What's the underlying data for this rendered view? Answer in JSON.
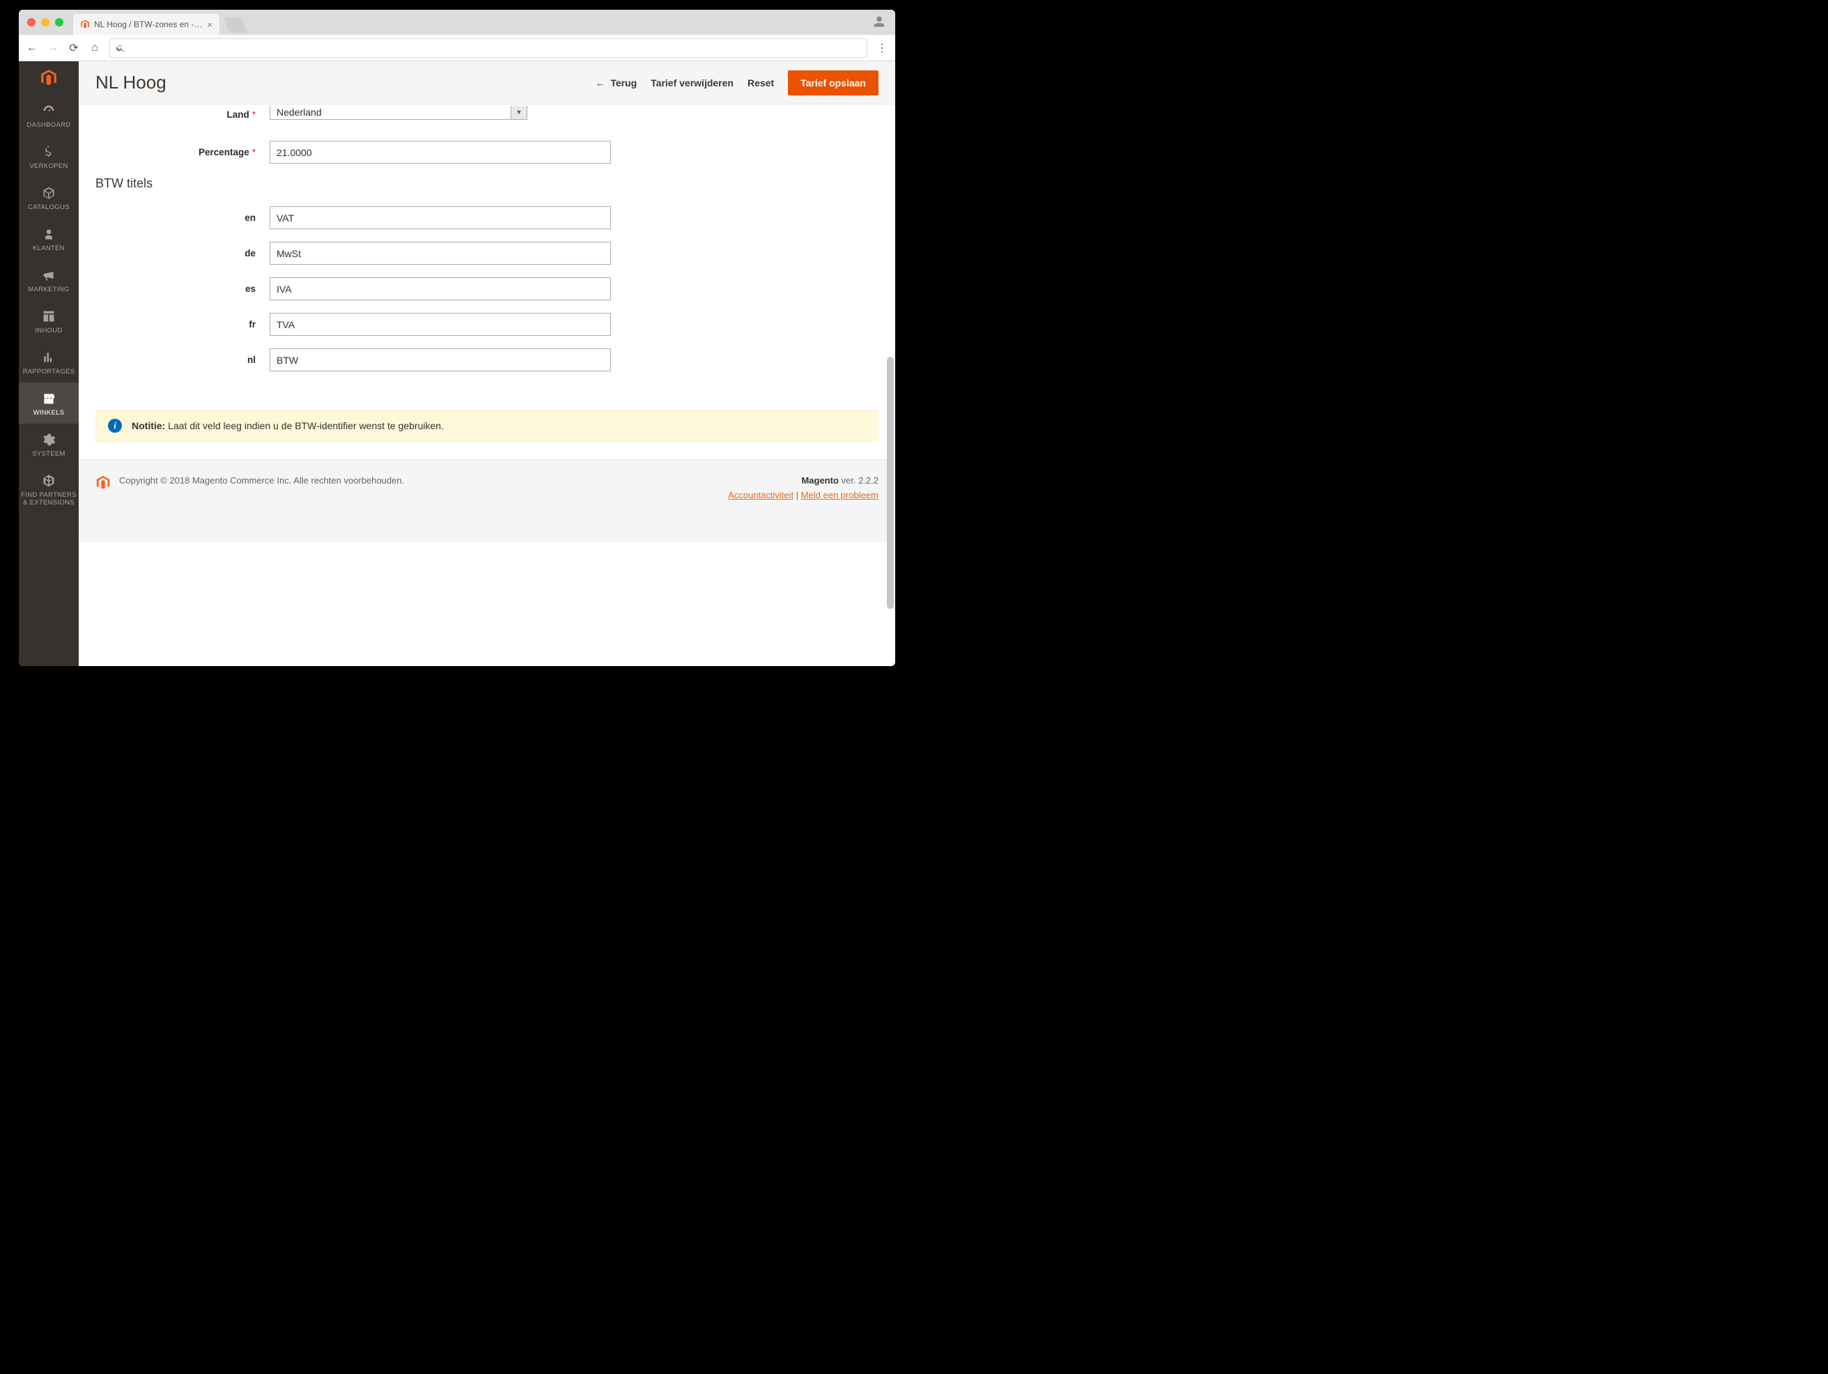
{
  "browser": {
    "tab_title": "NL Hoog / BTW-zones en -tarie"
  },
  "sidebar": {
    "items": [
      {
        "label": "DASHBOARD",
        "icon": "dashboard"
      },
      {
        "label": "VERKOPEN",
        "icon": "dollar"
      },
      {
        "label": "CATALOGUS",
        "icon": "cube"
      },
      {
        "label": "KLANTEN",
        "icon": "person"
      },
      {
        "label": "MARKETING",
        "icon": "megaphone"
      },
      {
        "label": "INHOUD",
        "icon": "layout"
      },
      {
        "label": "RAPPORTAGES",
        "icon": "bars"
      },
      {
        "label": "WINKELS",
        "icon": "store"
      },
      {
        "label": "SYSTEEM",
        "icon": "gear"
      },
      {
        "label": "FIND PARTNERS & EXTENSIONS",
        "icon": "box"
      }
    ],
    "active_index": 7
  },
  "header": {
    "title": "NL Hoog",
    "back": "Terug",
    "delete": "Tarief verwijderen",
    "reset": "Reset",
    "save": "Tarief opslaan"
  },
  "form": {
    "land_label": "Land",
    "land_value": "Nederland",
    "percentage_label": "Percentage",
    "percentage_value": "21.0000",
    "section_title": "BTW titels",
    "titles": [
      {
        "lang": "en",
        "value": "VAT"
      },
      {
        "lang": "de",
        "value": "MwSt"
      },
      {
        "lang": "es",
        "value": "IVA"
      },
      {
        "lang": "fr",
        "value": "TVA"
      },
      {
        "lang": "nl",
        "value": "BTW"
      }
    ]
  },
  "notice": {
    "label": "Notitie:",
    "text": "Laat dit veld leeg indien u de BTW-identifier wenst te gebruiken."
  },
  "footer": {
    "copyright": "Copyright © 2018 Magento Commerce Inc. Alle rechten voorbehouden.",
    "brand": "Magento",
    "version": " ver. 2.2.2",
    "link1": "Accountactiviteit",
    "sep": " | ",
    "link2": "Meld een probleem"
  }
}
